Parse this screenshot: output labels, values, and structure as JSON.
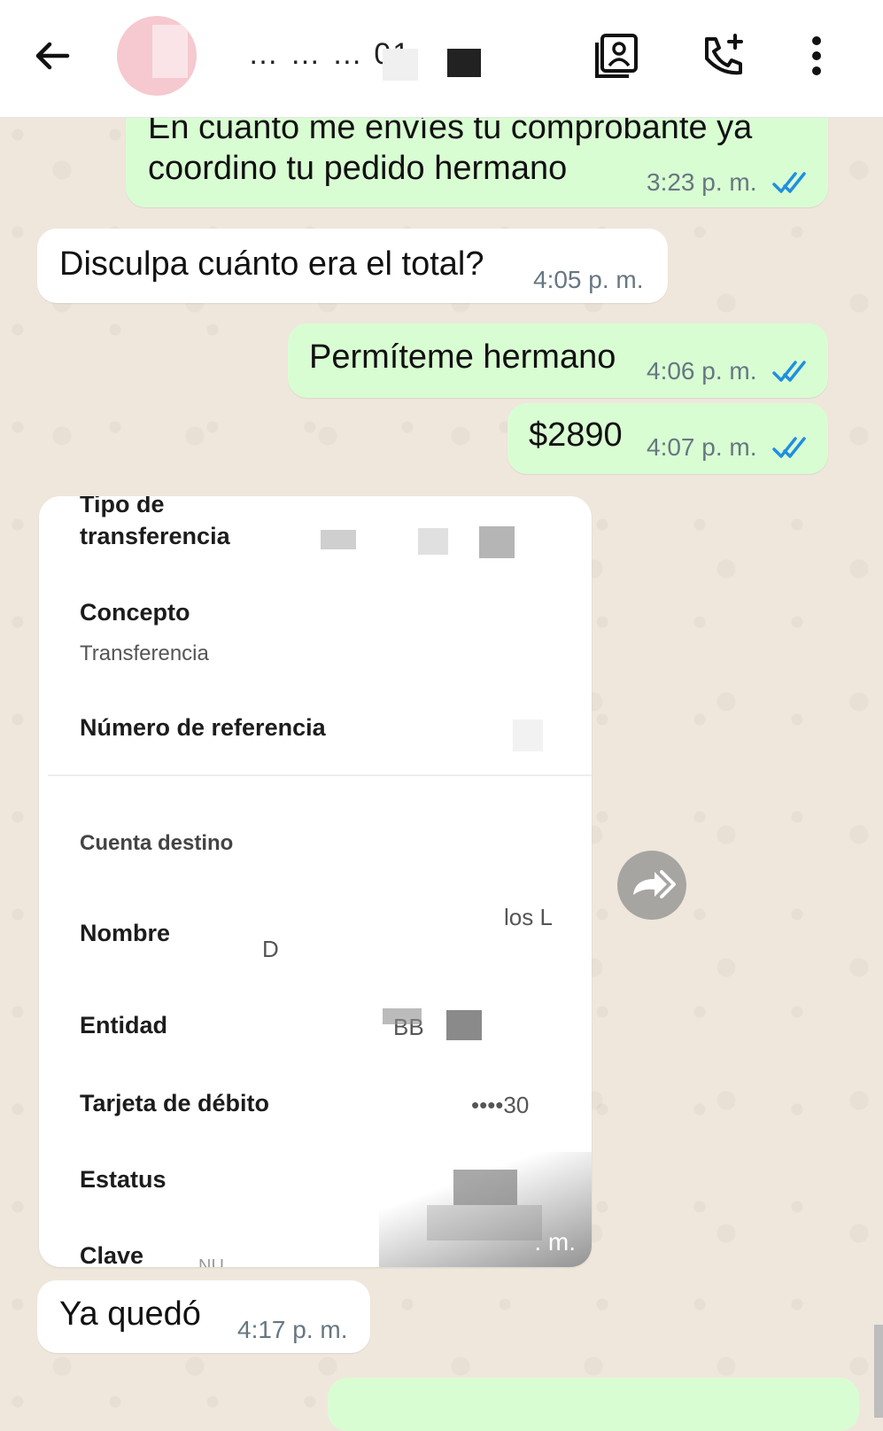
{
  "header": {
    "contact_name": "… … … 01"
  },
  "messages": [
    {
      "direction": "out",
      "text_line1": "En cuanto me envíes tu comprobante ya",
      "text_line2": "coordino tu pedido hermano",
      "time": "3:23 p. m.",
      "read": true
    },
    {
      "direction": "in",
      "text": "Disculpa cuánto era el total?",
      "time": "4:05 p. m."
    },
    {
      "direction": "out",
      "text": "Permíteme hermano",
      "time": "4:06 p. m.",
      "read": true
    },
    {
      "direction": "out",
      "text": "$2890",
      "time": "4:07 p. m.",
      "read": true
    },
    {
      "direction": "in",
      "text": "Ya quedó",
      "time": "4:17 p. m."
    }
  ],
  "receipt": {
    "tipo_label_top": "Tipo de",
    "tipo_label": "transferencia",
    "concepto_label": "Concepto",
    "concepto_value": "Transferencia",
    "referencia_label": "Número de referencia",
    "cuenta_destino": "Cuenta destino",
    "nombre_label": "Nombre",
    "nombre_value_part1": "los L",
    "nombre_value_part2": "D",
    "entidad_label": "Entidad",
    "entidad_value": "BB",
    "tarjeta_label": "Tarjeta de débito",
    "tarjeta_value": "••••30",
    "estatus_label": "Estatus",
    "clave_label": "Clave",
    "clave_value": "NU...",
    "image_time": ". m."
  },
  "colors": {
    "outgoing_bubble": "#d9fdd3",
    "incoming_bubble": "#ffffff",
    "read_ticks": "#53bdeb",
    "chat_background": "#efe7dc"
  }
}
